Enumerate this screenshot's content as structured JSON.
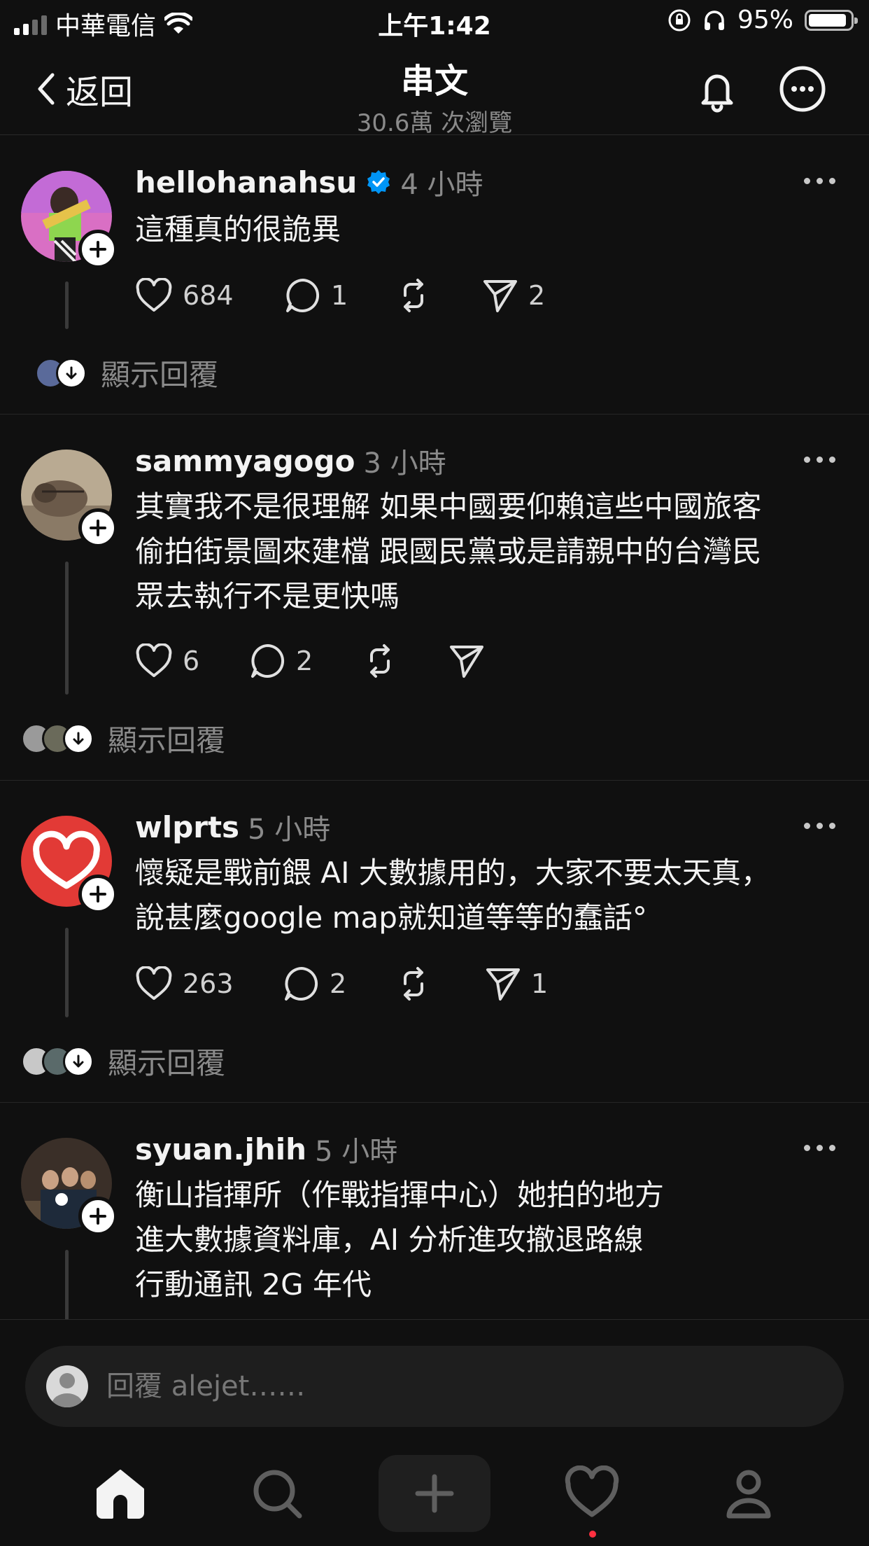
{
  "status_bar": {
    "carrier": "中華電信",
    "time": "上午1:42",
    "battery": "95%"
  },
  "header": {
    "back_label": "返回",
    "title": "串文",
    "subtitle": "30.6萬 次瀏覽"
  },
  "posts": [
    {
      "username": "hellohanahsu",
      "verified": true,
      "time": "4 小時",
      "text": "這種真的很詭異",
      "likes": "684",
      "comments": "1",
      "reposts": "",
      "shares": "2",
      "show_replies": "顯示回覆"
    },
    {
      "username": "sammyagogo",
      "verified": false,
      "time": "3 小時",
      "text": "其實我不是很理解 如果中國要仰賴這些中國旅客\n偷拍街景圖來建檔 跟國民黨或是請親中的台灣民\n眾去執行不是更快嗎",
      "likes": "6",
      "comments": "2",
      "reposts": "",
      "shares": "",
      "show_replies": "顯示回覆"
    },
    {
      "username": "wlprts",
      "verified": false,
      "time": "5 小時",
      "text": "懷疑是戰前餵 AI 大數據用的，大家不要太天真，\n說甚麼google  map就知道等等的蠢話°",
      "likes": "263",
      "comments": "2",
      "reposts": "",
      "shares": "1",
      "show_replies": "顯示回覆"
    },
    {
      "username": "syuan.jhih",
      "verified": false,
      "time": "5 小時",
      "text": "衡山指揮所（作戰指揮中心）她拍的地方\n進大數據資料庫，AI 分析進攻撤退路線\n行動通訊 2G 年代",
      "likes": "",
      "comments": "",
      "reposts": "",
      "shares": "",
      "show_replies": ""
    }
  ],
  "reply_bar": {
    "placeholder": "回覆 alejet……"
  },
  "colors": {
    "background": "#101010",
    "text": "#f3f3f3",
    "muted": "#8a8a8a",
    "verified": "#0095f6",
    "notification_dot": "#ff3040"
  },
  "tab_bar": {
    "icons": [
      "home-icon",
      "search-icon",
      "create-icon",
      "activity-icon",
      "profile-icon"
    ],
    "active": "home"
  }
}
